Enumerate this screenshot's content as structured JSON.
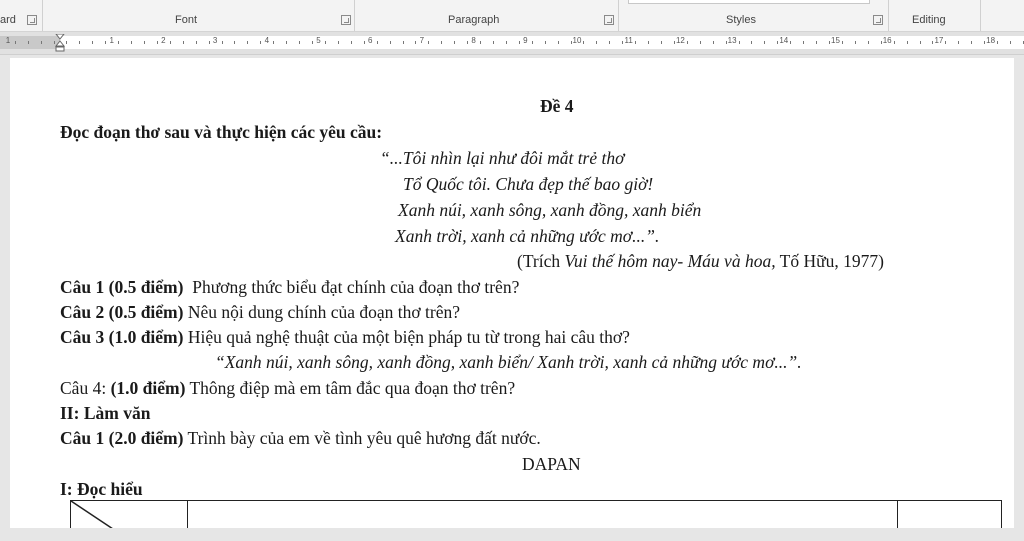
{
  "ribbon": {
    "groups": {
      "clipboard": "ard",
      "font": "Font",
      "paragraph": "Paragraph",
      "styles": "Styles",
      "editing": "Editing"
    }
  },
  "ruler": {
    "numbers": [
      "1",
      "1",
      "2",
      "3",
      "4",
      "5",
      "6",
      "7",
      "8",
      "9",
      "10",
      "11",
      "12",
      "13",
      "14",
      "15",
      "16",
      "17",
      "18"
    ]
  },
  "document": {
    "heading": "Đề 4",
    "instruction": "Đọc đoạn thơ sau và thực hiện các yêu cầu:",
    "poem": [
      "“...Tôi nhìn lại như đôi mắt trẻ thơ",
      "Tổ Quốc tôi. Chưa đẹp thế bao giờ!",
      "Xanh núi, xanh sông, xanh đồng, xanh biển",
      "Xanh trời, xanh cả những ước mơ...”."
    ],
    "citation_prefix": "(Trích ",
    "citation_italic": "Vui thế hôm nay- Máu và hoa,",
    "citation_suffix": " Tố Hữu, 1977)",
    "questions": [
      {
        "label": "Câu 1 (0.5 điểm)",
        "text": "  Phương thức biểu đạt chính của đoạn thơ trên?"
      },
      {
        "label": "Câu 2 (0.5 điểm)",
        "text": " Nêu nội dung chính của đoạn thơ trên?"
      },
      {
        "label": "Câu 3 (1.0 điểm)",
        "text": " Hiệu quả nghệ thuật của một biện pháp tu từ trong hai câu thơ?"
      }
    ],
    "quote_line": "“Xanh núi, xanh sông, xanh đồng, xanh biển/ Xanh trời, xanh cả những ước mơ...”.",
    "question4_prefix": "Câu 4: ",
    "question4_label": "(1.0 điểm)",
    "question4_text": " Thông điệp mà em tâm đắc qua đoạn thơ trên?",
    "section2": "II: Làm văn",
    "essay_label": "Câu 1 (2.0 điểm)",
    "essay_text": " Trình bày của em về tình yêu quê hương đất nước.",
    "answer_title": "DAPAN",
    "section1": "I: Đọc hiểu"
  }
}
